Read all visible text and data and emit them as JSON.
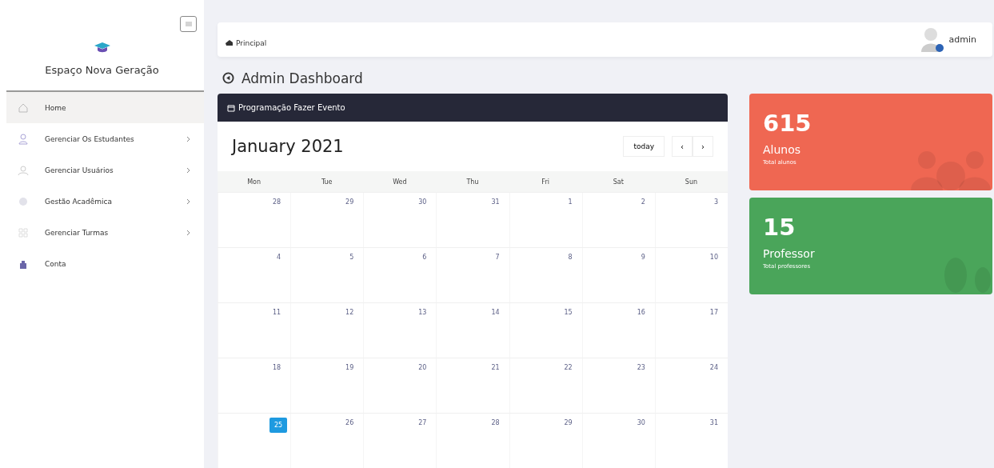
{
  "sidebar": {
    "brand": "Espaço Nova Geração",
    "items": [
      {
        "label": "Home",
        "selected": true,
        "has_children": false
      },
      {
        "label": "Gerenciar Os Estudantes",
        "selected": false,
        "has_children": true
      },
      {
        "label": "Gerenciar Usuários",
        "selected": false,
        "has_children": true
      },
      {
        "label": "Gestão Acadêmica",
        "selected": false,
        "has_children": true
      },
      {
        "label": "Gerenciar Turmas",
        "selected": false,
        "has_children": true
      },
      {
        "label": "Conta",
        "selected": false,
        "has_children": false
      }
    ]
  },
  "topbar": {
    "breadcrumb": "Principal",
    "user": "admin"
  },
  "page_title": "Admin Dashboard",
  "calendar": {
    "header": "Programação Fazer Evento",
    "month": "January 2021",
    "today_button": "today",
    "prev": "‹",
    "next": "›",
    "weekdays": [
      "Mon",
      "Tue",
      "Wed",
      "Thu",
      "Fri",
      "Sat",
      "Sun"
    ],
    "weeks": [
      [
        {
          "day": "28",
          "today": false
        },
        {
          "day": "29",
          "today": false
        },
        {
          "day": "30",
          "today": false
        },
        {
          "day": "31",
          "today": false
        },
        {
          "day": "1",
          "today": false
        },
        {
          "day": "2",
          "today": false
        },
        {
          "day": "3",
          "today": false
        }
      ],
      [
        {
          "day": "4",
          "today": false
        },
        {
          "day": "5",
          "today": false
        },
        {
          "day": "6",
          "today": false
        },
        {
          "day": "7",
          "today": false
        },
        {
          "day": "8",
          "today": false
        },
        {
          "day": "9",
          "today": false
        },
        {
          "day": "10",
          "today": false
        }
      ],
      [
        {
          "day": "11",
          "today": false
        },
        {
          "day": "12",
          "today": false
        },
        {
          "day": "13",
          "today": false
        },
        {
          "day": "14",
          "today": false
        },
        {
          "day": "15",
          "today": false
        },
        {
          "day": "16",
          "today": false
        },
        {
          "day": "17",
          "today": false
        }
      ],
      [
        {
          "day": "18",
          "today": false
        },
        {
          "day": "19",
          "today": false
        },
        {
          "day": "20",
          "today": false
        },
        {
          "day": "21",
          "today": false
        },
        {
          "day": "22",
          "today": false
        },
        {
          "day": "23",
          "today": false
        },
        {
          "day": "24",
          "today": false
        }
      ],
      [
        {
          "day": "25",
          "today": true
        },
        {
          "day": "26",
          "today": false
        },
        {
          "day": "27",
          "today": false
        },
        {
          "day": "28",
          "today": false
        },
        {
          "day": "29",
          "today": false
        },
        {
          "day": "30",
          "today": false
        },
        {
          "day": "31",
          "today": false
        }
      ]
    ]
  },
  "stats": [
    {
      "value": "615",
      "label": "Alunos",
      "sublabel": "Total alunos",
      "color": "#ef6752"
    },
    {
      "value": "15",
      "label": "Professor",
      "sublabel": "Total professores",
      "color": "#4aa55a"
    }
  ]
}
